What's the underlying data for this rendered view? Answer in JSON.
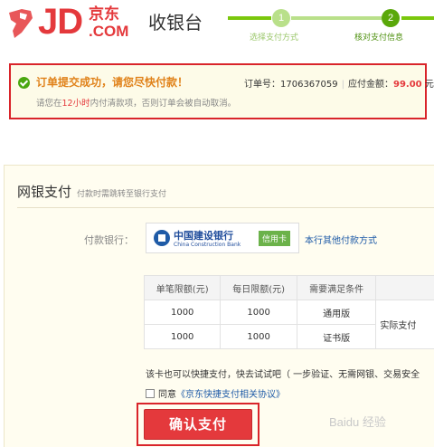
{
  "header": {
    "logo_jd": "JD",
    "logo_cn": "京东",
    "logo_com": ".COM",
    "cashier": "收银台",
    "steps": [
      {
        "num": "1",
        "label": "选择支付方式",
        "state": "done"
      },
      {
        "num": "2",
        "label": "核对支付信息",
        "state": "current"
      }
    ]
  },
  "banner": {
    "icon": "check-circle-icon",
    "title": "订单提交成功，请您尽快付款！",
    "order_label": "订单号：",
    "order_number": "1706367059",
    "amount_label": "应付金额：",
    "amount": "99.00",
    "amount_unit": "元",
    "remind_pre": "请您在",
    "remind_hours": "12小时",
    "remind_post": "内付清款项，否则订单会被自动取消。"
  },
  "payment": {
    "title": "网银支付",
    "subtitle": "付款时需跳转至银行支付",
    "bank_label": "付款银行：",
    "bank_name_cn": "中国建设银行",
    "bank_name_en": "China Construction Bank",
    "card_type": "信用卡",
    "other_link": "本行其他付款方式",
    "table": {
      "headers": [
        "单笔限额(元)",
        "每日限额(元)",
        "需要满足条件",
        ""
      ],
      "rows": [
        [
          "1000",
          "1000",
          "通用版",
          "实际支付"
        ],
        [
          "1000",
          "1000",
          "证书版",
          ""
        ]
      ]
    },
    "quick_text": "该卡也可以快捷支付，快去试试吧（ 一步验证、无需网银、交易安全",
    "agree_text": "同意",
    "agree_link": "《京东快捷支付相关协议》",
    "confirm_label": "确认支付"
  },
  "watermark": "Baidu 经验",
  "colors": {
    "brand": "#e4393c",
    "step_green": "#5aa80a",
    "link": "#1f5ba7",
    "highlight": "#d9242a"
  }
}
